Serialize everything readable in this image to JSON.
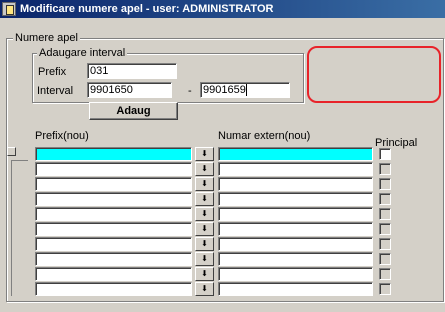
{
  "window": {
    "title": "Modificare numere apel - user: ADMINISTRATOR"
  },
  "main_group": {
    "label": "Numere apel"
  },
  "interval_group": {
    "label": "Adaugare interval",
    "prefix_label": "Prefix",
    "prefix_value": "031",
    "interval_label": "Interval",
    "interval_from": "9901650",
    "separator": "-",
    "interval_to": "9901659",
    "add_button": "Adaug"
  },
  "grid": {
    "columns": {
      "prefix": "Prefix(nou)",
      "external": "Numar extern(nou)",
      "principal": "Principal"
    },
    "rows": [
      {
        "prefix": "",
        "external": "",
        "principal": false,
        "active": true
      },
      {
        "prefix": "",
        "external": "",
        "principal": false,
        "active": false
      },
      {
        "prefix": "",
        "external": "",
        "principal": false,
        "active": false
      },
      {
        "prefix": "",
        "external": "",
        "principal": false,
        "active": false
      },
      {
        "prefix": "",
        "external": "",
        "principal": false,
        "active": false
      },
      {
        "prefix": "",
        "external": "",
        "principal": false,
        "active": false
      },
      {
        "prefix": "",
        "external": "",
        "principal": false,
        "active": false
      },
      {
        "prefix": "",
        "external": "",
        "principal": false,
        "active": false
      },
      {
        "prefix": "",
        "external": "",
        "principal": false,
        "active": false
      },
      {
        "prefix": "",
        "external": "",
        "principal": false,
        "active": false
      }
    ]
  },
  "icons": {
    "app": "form-icon",
    "dropdown": "list-arrow-icon"
  },
  "colors": {
    "active_row": "#00ffff",
    "highlight": "#e8232a",
    "titlebar": "#0a246a"
  }
}
